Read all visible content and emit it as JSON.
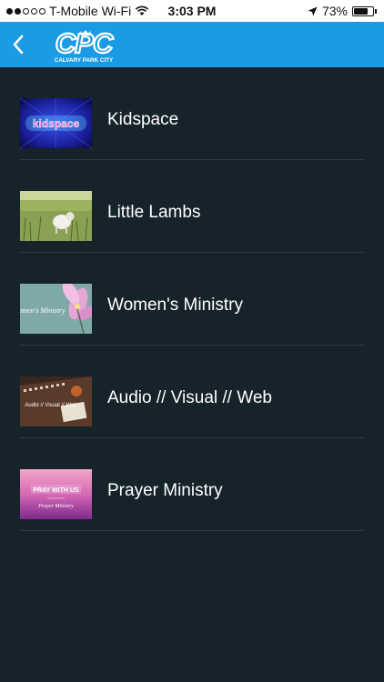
{
  "status_bar": {
    "carrier": "T-Mobile Wi-Fi",
    "time": "3:03 PM",
    "battery_text": "73%",
    "battery_level": 0.73,
    "signal_bars_filled": 2,
    "signal_bars_total": 5
  },
  "header": {
    "logo_text": "CPC",
    "logo_subtitle": "CALVARY PARK CITY",
    "accent_color": "#1b9be3"
  },
  "ministries": [
    {
      "label": "Kidspace",
      "thumb_text": "kidspace",
      "icon": "kidspace-thumbnail"
    },
    {
      "label": "Little Lambs",
      "thumb_text": "",
      "icon": "lamb-thumbnail"
    },
    {
      "label": "Women's Ministry",
      "thumb_text": "Women's Ministry",
      "icon": "flower-thumbnail"
    },
    {
      "label": "Audio // Visual // Web",
      "thumb_text": "Audio // Visual // Web",
      "icon": "mixer-thumbnail"
    },
    {
      "label": "Prayer Ministry",
      "thumb_text": "PRAY WITH US",
      "thumb_subtext": "Prayer Ministry",
      "icon": "prayer-thumbnail"
    }
  ]
}
